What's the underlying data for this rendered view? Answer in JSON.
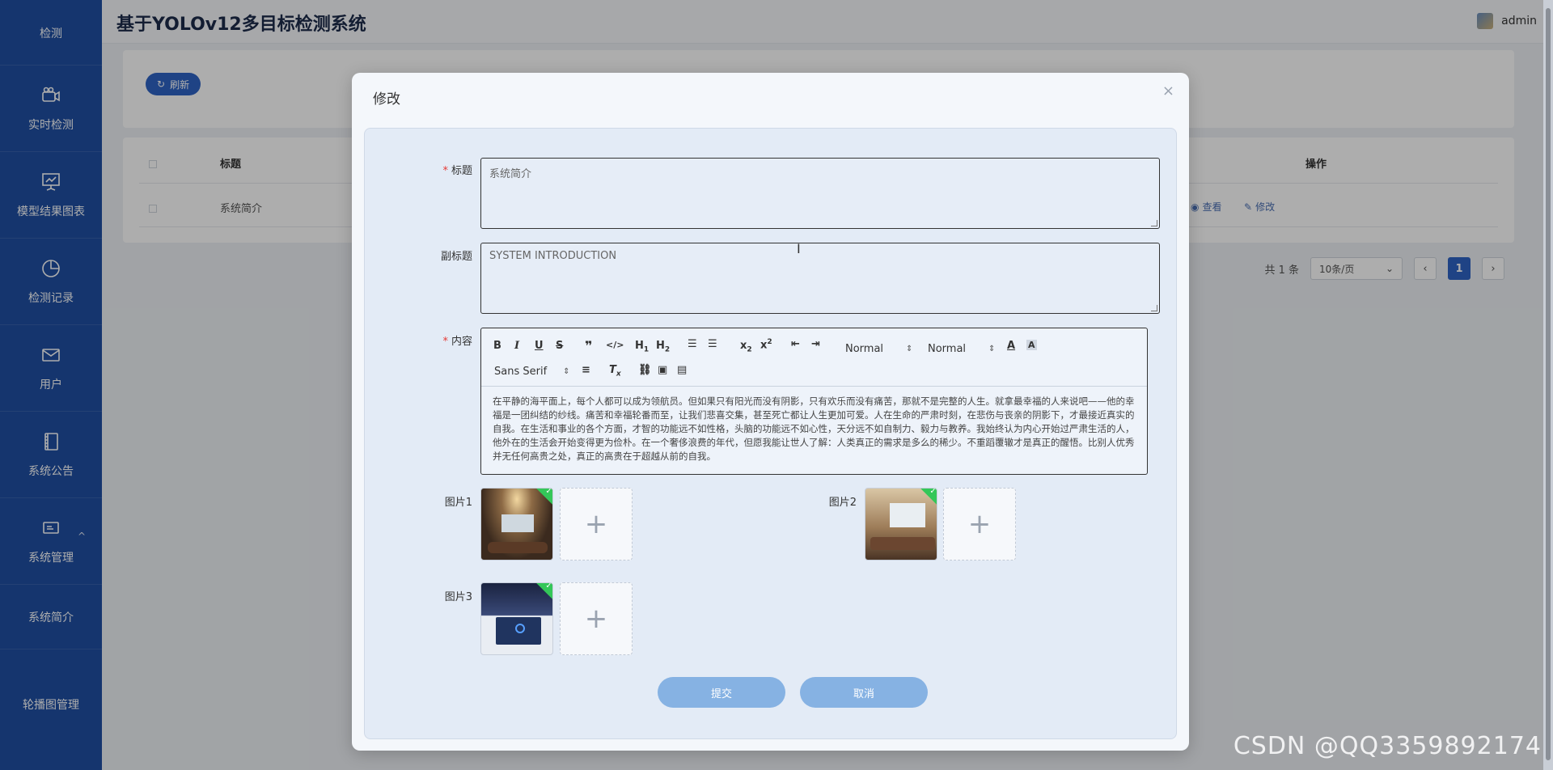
{
  "app": {
    "title": "基于YOLOv12多目标检测系统",
    "user": "admin"
  },
  "sidebar": {
    "items": [
      {
        "label": "检测",
        "icon": "detect-icon"
      },
      {
        "label": "实时检测",
        "icon": "camera-icon"
      },
      {
        "label": "模型结果图表",
        "icon": "chart-board-icon"
      },
      {
        "label": "检测记录",
        "icon": "pie-chart-icon"
      },
      {
        "label": "用户",
        "icon": "mail-icon"
      },
      {
        "label": "系统公告",
        "icon": "book-icon"
      },
      {
        "label": "系统管理",
        "icon": "id-card-icon"
      },
      {
        "label": "系统简介",
        "icon": ""
      },
      {
        "label": "轮播图管理",
        "icon": ""
      }
    ]
  },
  "page": {
    "refresh_label": "刷新",
    "table": {
      "headers": {
        "title": "标题",
        "ops": "操作"
      },
      "rows": [
        {
          "title": "系统简介",
          "view": "查看",
          "edit": "修改"
        }
      ]
    },
    "pager": {
      "total": "共 1 条",
      "page_size": "10条/页",
      "current": "1"
    }
  },
  "modal": {
    "title": "修改",
    "fields": {
      "title_label": "标题",
      "title_value": "系统简介",
      "subtitle_label": "副标题",
      "subtitle_value": "SYSTEM INTRODUCTION",
      "content_label": "内容",
      "content_value": "在平静的海平面上，每个人都可以成为领航员。但如果只有阳光而没有阴影，只有欢乐而没有痛苦，那就不是完整的人生。就拿最幸福的人来说吧——他的幸福是一团纠结的纱线。痛苦和幸福轮番而至，让我们悲喜交集，甚至死亡都让人生更加可爱。人在生命的严肃时刻，在悲伤与丧亲的阴影下，才最接近真实的自我。在生活和事业的各个方面，才智的功能远不如性格，头脑的功能远不如心性，天分远不如自制力、毅力与教养。我始终认为内心开始过严肃生活的人，他外在的生活会开始变得更为俭朴。在一个奢侈浪费的年代，但愿我能让世人了解：人类真正的需求是多么的稀少。不重蹈覆辙才是真正的醒悟。比别人优秀并无任何高贵之处，真正的高贵在于超越从前的自我。",
      "image1_label": "图片1",
      "image2_label": "图片2",
      "image3_label": "图片3"
    },
    "editor": {
      "header_select": "Normal",
      "size_select": "Normal",
      "font_select": "Sans Serif"
    },
    "buttons": {
      "submit": "提交",
      "cancel": "取消"
    }
  },
  "watermark": "CSDN @QQ3359892174"
}
